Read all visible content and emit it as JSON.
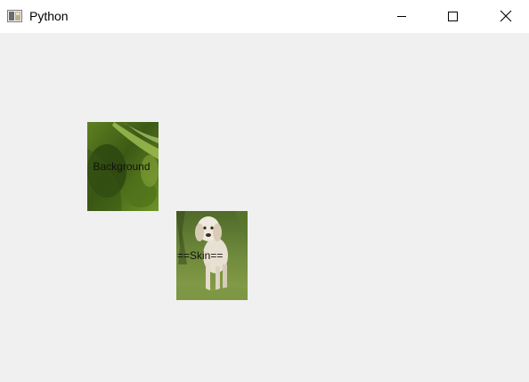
{
  "window": {
    "title": "Python",
    "icons": {
      "app": "python-tk-window-icon",
      "minimize": "minimize-icon",
      "maximize": "maximize-icon",
      "close": "close-icon"
    }
  },
  "labels": [
    {
      "text": "Background",
      "image": "green-leaf-photo"
    },
    {
      "text": "==Skin==",
      "image": "white-puppy-on-grass-photo"
    }
  ],
  "colors": {
    "titlebar": "#ffffff",
    "client_area": "#f0f0f0",
    "leaf_dark": "#2f4a12",
    "leaf_light": "#8fae3a",
    "grass": "#6f8a3c",
    "puppy": "#e8e0d2"
  }
}
